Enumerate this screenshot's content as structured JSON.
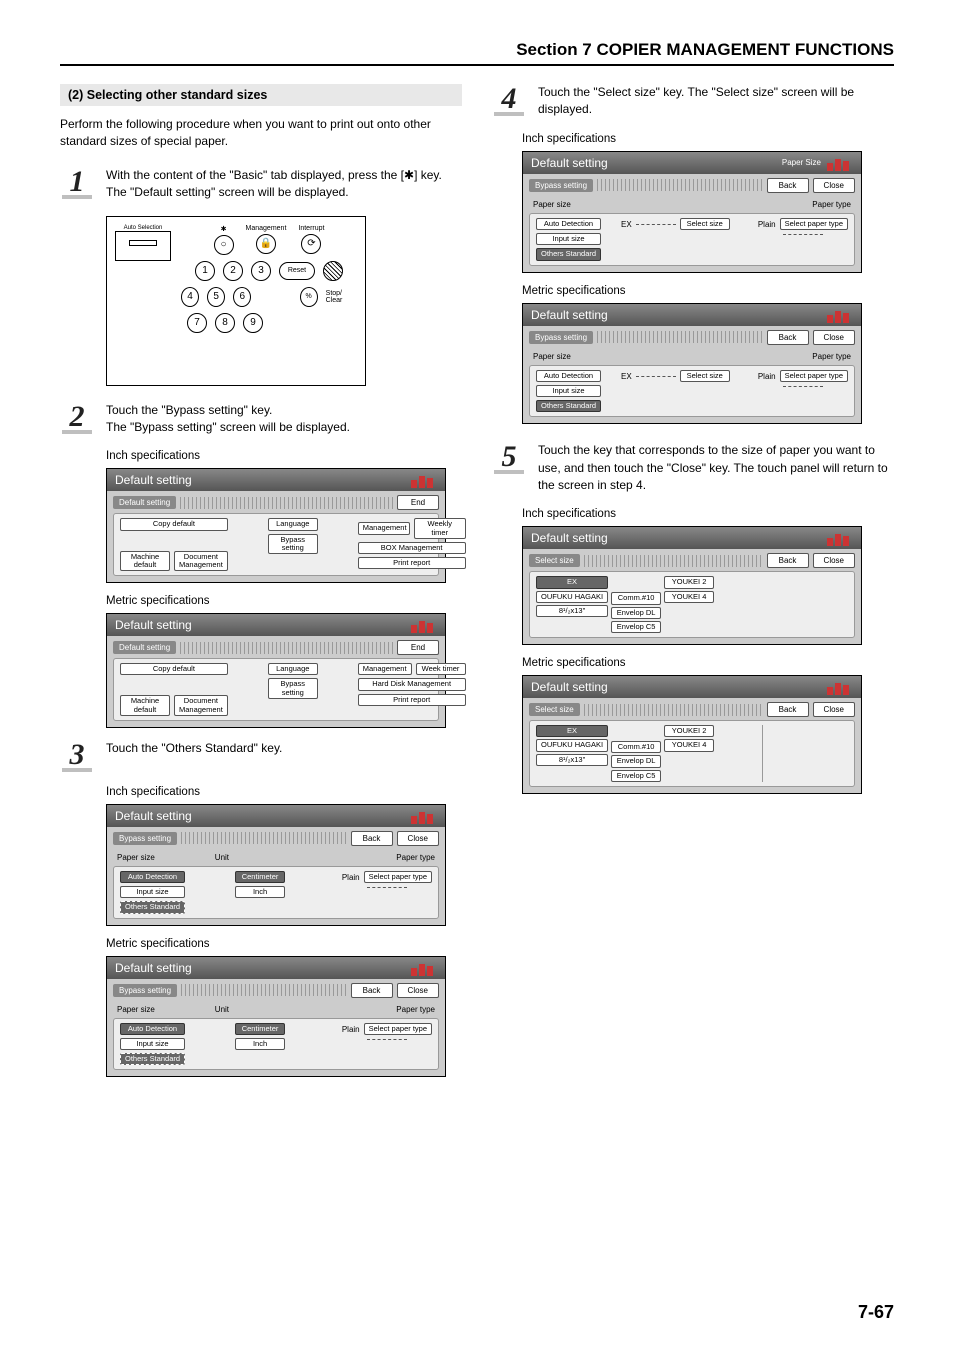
{
  "header": {
    "section": "Section 7  COPIER MANAGEMENT FUNCTIONS"
  },
  "left": {
    "heading": "(2) Selecting other standard sizes",
    "intro": "Perform the following procedure when you want to print out onto other standard sizes of special paper.",
    "step1": "With the content of the \"Basic\" tab displayed, press the [✱] key. The \"Default setting\" screen will be displayed.",
    "step2a": "Touch the \"Bypass setting\" key.",
    "step2b": "The \"Bypass setting\" screen will be displayed.",
    "step3": "Touch the \"Others Standard\" key.",
    "inch": "Inch specifications",
    "metric": "Metric specifications"
  },
  "right": {
    "step4": "Touch the \"Select size\" key. The \"Select size\" screen will be displayed.",
    "step5": "Touch the key that corresponds to the size of paper you want to use, and then touch the \"Close\" key. The touch panel will return to the screen in step 4.",
    "inch": "Inch specifications",
    "metric": "Metric specifications"
  },
  "panel": {
    "auto_sel": "Auto Selection",
    "keys": {
      "management": "Management",
      "interrupt": "Interrupt",
      "reset": "Reset",
      "stop": "Stop/\nClear",
      "pct": "%"
    },
    "digits": [
      "1",
      "2",
      "3",
      "4",
      "5",
      "6",
      "7",
      "8",
      "9"
    ]
  },
  "screens": {
    "default_title": "Default setting",
    "crumb_default": "Default setting",
    "crumb_bypass": "Bypass setting",
    "crumb_select": "Select size",
    "end": "End",
    "back": "Back",
    "close": "Close",
    "paper_size_corner": "Paper Size",
    "defA": {
      "copy_default": "Copy default",
      "language": "Language",
      "management": "Management",
      "weekly_timer": "Weekly timer",
      "bypass_setting": "Bypass setting",
      "box_mgmt": "BOX Management",
      "machine_default": "Machine default",
      "doc_mgmt": "Document Management",
      "print_report": "Print report"
    },
    "defB": {
      "week_timer": "Week timer",
      "hard_disk": "Hard Disk Management"
    },
    "bypass": {
      "paper_size": "Paper size",
      "unit": "Unit",
      "paper_type": "Paper type",
      "auto_detect": "Auto Detection",
      "input_size": "Input size",
      "others_std": "Others Standard",
      "centimeter": "Centimeter",
      "inch": "Inch",
      "plain": "Plain",
      "select_paper_type": "Select paper type",
      "ex": "EX",
      "select_size": "Select size"
    },
    "selsize": {
      "ex": "EX",
      "oufuku": "OUFUKU HAGAKI",
      "size813": "8¹/₂x13\"",
      "comm10": "Comm.#10",
      "env_dl": "Envelop DL",
      "env_c5": "Envelop C5",
      "youkei2": "YOUKEI 2",
      "youkei4": "YOUKEI 4"
    }
  },
  "pagenum": "7-67"
}
